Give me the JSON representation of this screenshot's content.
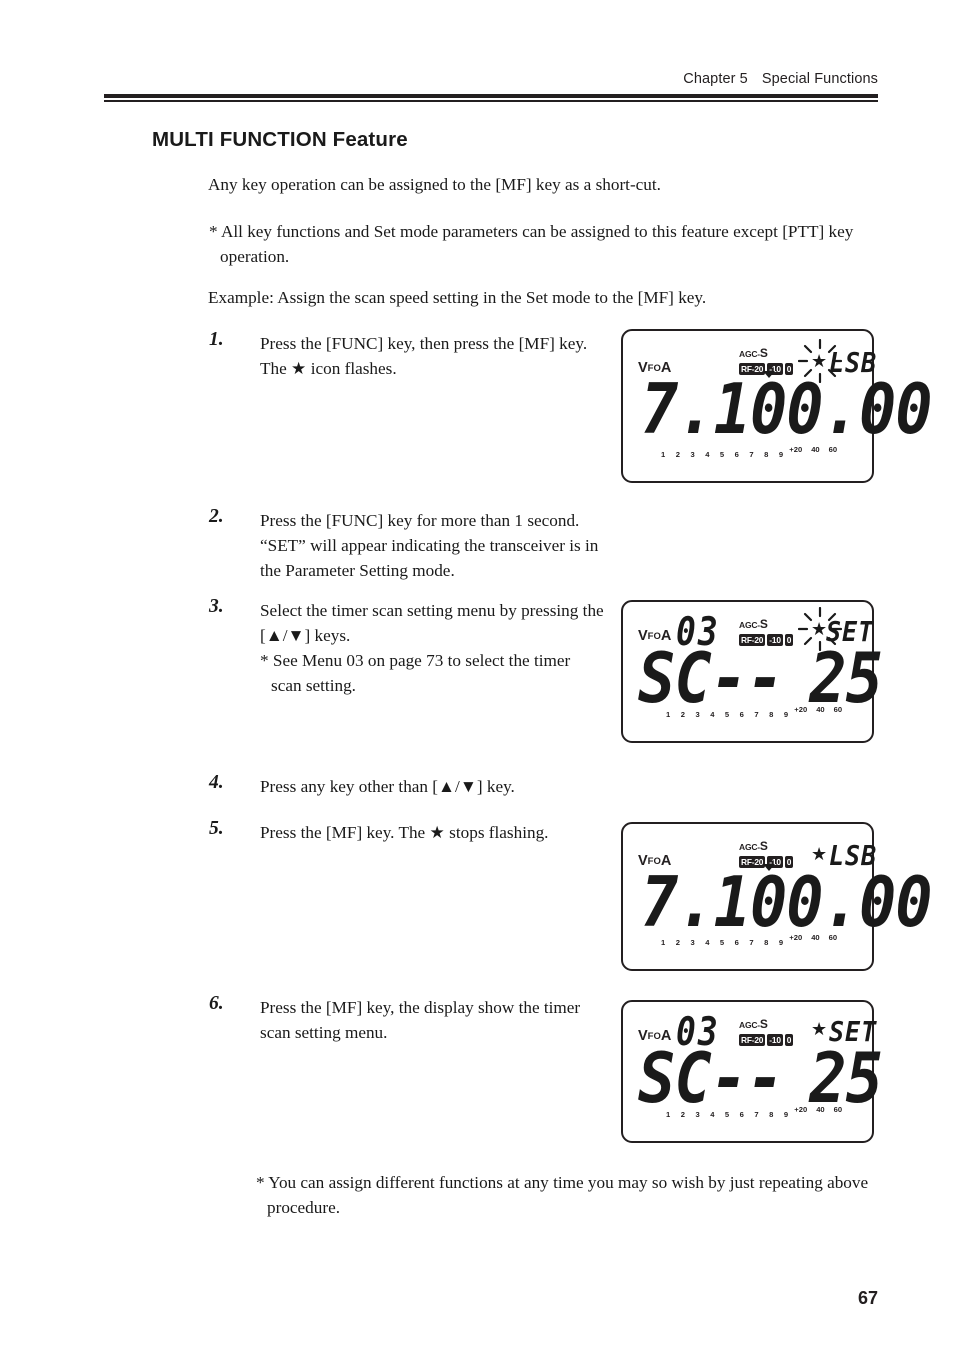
{
  "header": {
    "chapter": "Chapter 5",
    "section": "Special Functions"
  },
  "page_number": "67",
  "title": "MULTI FUNCTION Feature",
  "intro": "Any key operation can be assigned to the [MF] key as a short-cut.",
  "note": "* All key functions and Set mode parameters can be assigned to this feature except [PTT] key operation.",
  "example": "Example: Assign the scan speed setting in the Set mode to the [MF] key.",
  "footnote": "* You can assign different functions at any time you may so wish by just repeating above procedure.",
  "steps": [
    {
      "number": "1.",
      "text": "Press the [FUNC] key, then press the [MF] key. The ★ icon flashes."
    },
    {
      "number": "2.",
      "text": "Press the [FUNC] key for more than 1 second. “SET” will appear indicating the transceiver is in the Parameter Setting mode."
    },
    {
      "number": "3.",
      "text": "Select the timer scan setting menu by pressing the [▲/▼] keys.",
      "sub": "* See Menu 03 on page 73 to select the timer",
      "sub2": "scan setting."
    },
    {
      "number": "4.",
      "text": "Press any key other than [▲/▼] key."
    },
    {
      "number": "5.",
      "text": "Press the [MF] key. The ★ stops flashing."
    },
    {
      "number": "6.",
      "text": "Press the [MF] key, the display show the timer scan setting menu."
    }
  ],
  "lcd_common": {
    "vfo_label_big_1": "V",
    "vfo_label_small": "FO",
    "vfo_label_big_2": "A",
    "agc_prefix": "AGC-",
    "agc_value": "S",
    "rf_badge": "RF-20",
    "badge_minus10": "-10",
    "badge_zero": "0",
    "star_icon": "★",
    "smeter_ticks": "1 2 3 4 5 6 7 8 9",
    "smeter_plus20": "+20",
    "smeter_40": "40",
    "smeter_60": "60"
  },
  "displays": [
    {
      "id": "lcd-step1",
      "menu_number": "",
      "mode_text": "LSB",
      "main_readout": "7.100.00",
      "star_flashing": true
    },
    {
      "id": "lcd-step3",
      "menu_number": "03",
      "mode_text": "SET",
      "main_left": "SC",
      "main_dashes": "--",
      "main_right": "25",
      "star_flashing": true
    },
    {
      "id": "lcd-step5",
      "menu_number": "",
      "mode_text": "LSB",
      "main_readout": "7.100.00",
      "star_flashing": false
    },
    {
      "id": "lcd-step6",
      "menu_number": "03",
      "mode_text": "SET",
      "main_left": "SC",
      "main_dashes": "--",
      "main_right": "25",
      "star_flashing": false
    }
  ],
  "colors": {
    "ink": "#1a1a1a",
    "rule": "#231f20",
    "paper": "#ffffff"
  }
}
